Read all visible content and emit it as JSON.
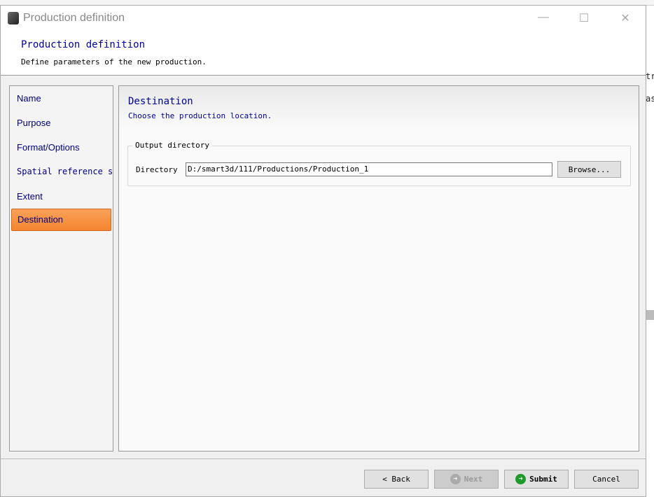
{
  "window": {
    "title": "Production definition"
  },
  "header": {
    "title": "Production definition",
    "subtitle": "Define parameters of the new production."
  },
  "sidebar": {
    "items": [
      {
        "label": "Name"
      },
      {
        "label": "Purpose"
      },
      {
        "label": "Format/Options"
      },
      {
        "label": "Spatial reference system"
      },
      {
        "label": "Extent"
      },
      {
        "label": "Destination"
      }
    ],
    "selected": "Destination"
  },
  "main": {
    "title": "Destination",
    "subtitle": "Choose the production location.",
    "group_label": "Output directory",
    "directory_label": "Directory",
    "directory_value": "D:/smart3d/111/Productions/Production_1",
    "browse_label": "Browse..."
  },
  "footer": {
    "back": "< Back",
    "next": "Next",
    "submit": "Submit",
    "cancel": "Cancel"
  },
  "background": {
    "fragments": [
      "tr",
      "as"
    ]
  },
  "colors": {
    "accent": "#f5852f",
    "title_blue": "#000099"
  }
}
